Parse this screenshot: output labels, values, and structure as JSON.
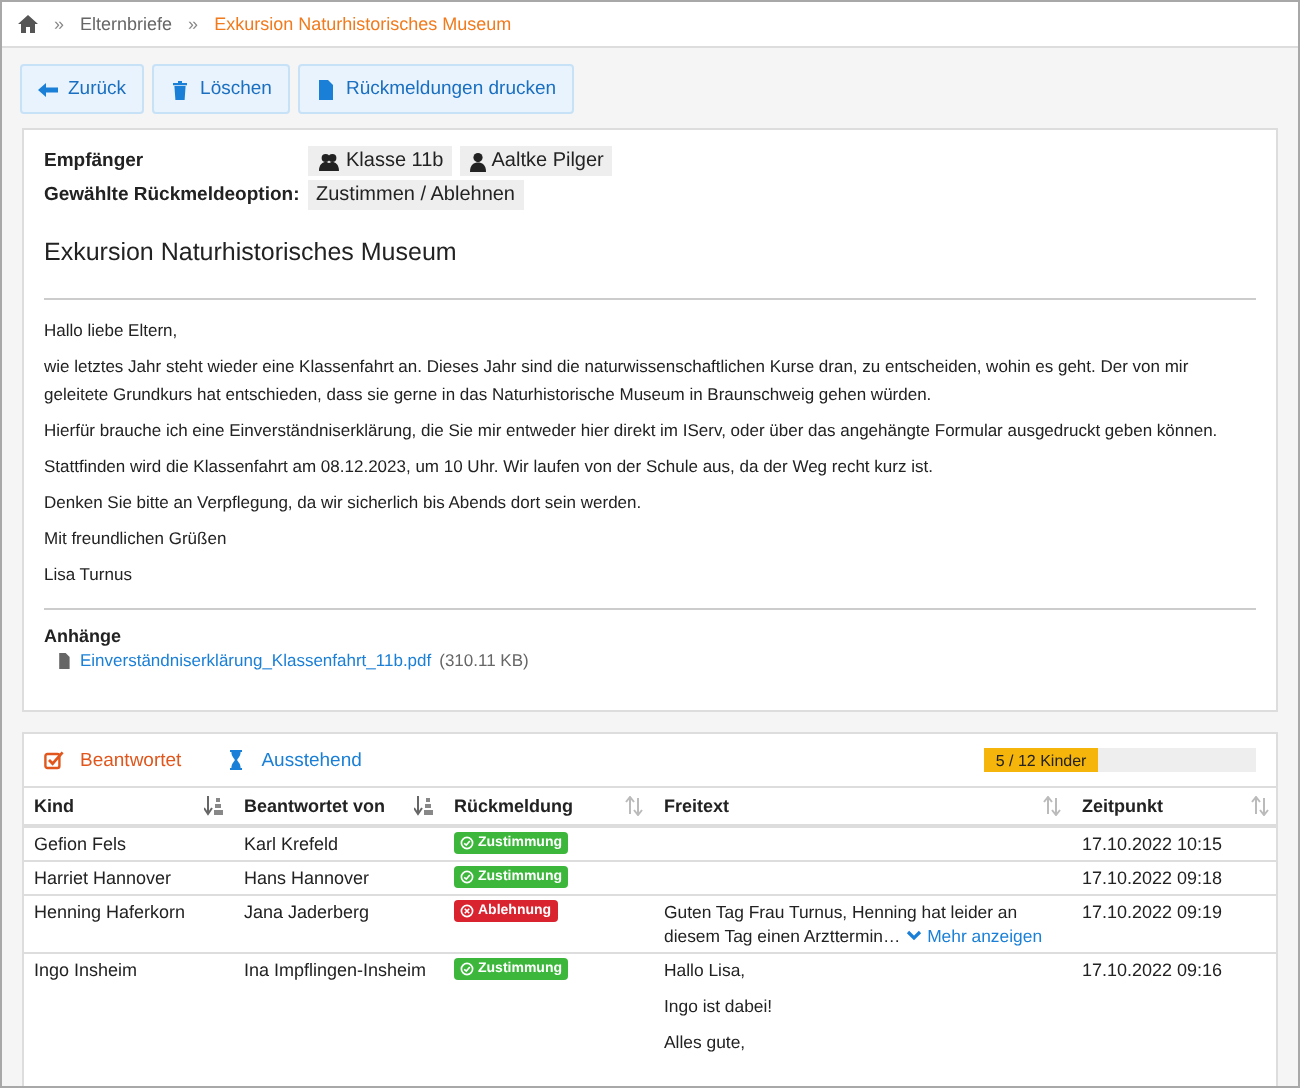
{
  "breadcrumb": [
    "Elternbriefe",
    "Exkursion Naturhistorisches Museum"
  ],
  "breadcrumb_separator": "»",
  "toolbar": [
    {
      "label": "Zurück",
      "kind": "back"
    },
    {
      "label": "Löschen",
      "kind": "delete"
    },
    {
      "label": "Rückmeldungen drucken",
      "kind": "print"
    }
  ],
  "letter": {
    "recipients_label": "Empfänger",
    "recipients": [
      {
        "label": "Klasse 11b",
        "kind": "group"
      },
      {
        "label": "Aaltke Pilger",
        "kind": "person"
      }
    ],
    "option_label": "Gewählte Rückmeldeoption:",
    "option": "Zustimmen / Ablehnen",
    "title": "Exkursion Naturhistorisches Museum",
    "paragraphs": [
      "Hallo liebe Eltern,",
      "wie letztes Jahr steht wieder eine Klassenfahrt an. Dieses Jahr sind die naturwissenschaftlichen Kurse dran, zu entscheiden, wohin es geht. Der von mir geleitete Grundkurs hat entschieden, dass sie gerne in das Naturhistorische Museum in Braunschweig gehen würden.",
      "Hierfür brauche ich eine Einverständniserklärung, die Sie mir entweder hier direkt im IServ, oder über das angehängte Formular ausgedruckt geben können.",
      "Stattfinden wird die Klassenfahrt am 08.12.2023, um 10 Uhr. Wir laufen von der Schule aus, da der Weg recht kurz ist.",
      "Denken Sie bitte an Verpflegung, da wir sicherlich bis Abends dort sein werden.",
      "Mit freundlichen Grüßen",
      "Lisa Turnus"
    ],
    "attachments_label": "Anhänge",
    "attachments": [
      {
        "name": "Einverständniserklärung_Klassenfahrt_11b.pdf",
        "size": "(310.11 KB)"
      }
    ]
  },
  "responses": {
    "tabs": [
      {
        "label": "Beantwortet",
        "kind": "answered",
        "selected": true
      },
      {
        "label": "Ausstehend",
        "kind": "pending",
        "selected": false
      }
    ],
    "progress": {
      "label": "5 / 12 Kinder",
      "level": 0.42
    },
    "columns": [
      "Kind",
      "Beantwortet von",
      "Rückmeldung",
      "Freitext",
      "Zeitpunkt"
    ],
    "rows": [
      {
        "child": "Gefion Fels",
        "by": "Karl Krefeld",
        "response": {
          "label": "Zustimmung",
          "kind": "approve"
        },
        "text": [],
        "time": "17.10.2022 10:15"
      },
      {
        "child": "Harriet Hannover",
        "by": "Hans Hannover",
        "response": {
          "label": "Zustimmung",
          "kind": "approve"
        },
        "text": [],
        "time": "17.10.2022 09:18"
      },
      {
        "child": "Henning Haferkorn",
        "by": "Jana Jaderberg",
        "response": {
          "label": "Ablehnung",
          "kind": "decline"
        },
        "text": [
          "Guten Tag Frau Turnus, Henning hat leider an diesem Tag einen Arzttermin…"
        ],
        "more": "Mehr anzeigen",
        "time": "17.10.2022 09:19"
      },
      {
        "child": "Ingo Insheim",
        "by": "Ina Impflingen-Insheim",
        "response": {
          "label": "Zustimmung",
          "kind": "approve"
        },
        "text": [
          "Hallo Lisa,",
          "Ingo ist dabei!",
          "Alles gute,"
        ],
        "time": "17.10.2022 09:16"
      }
    ]
  }
}
